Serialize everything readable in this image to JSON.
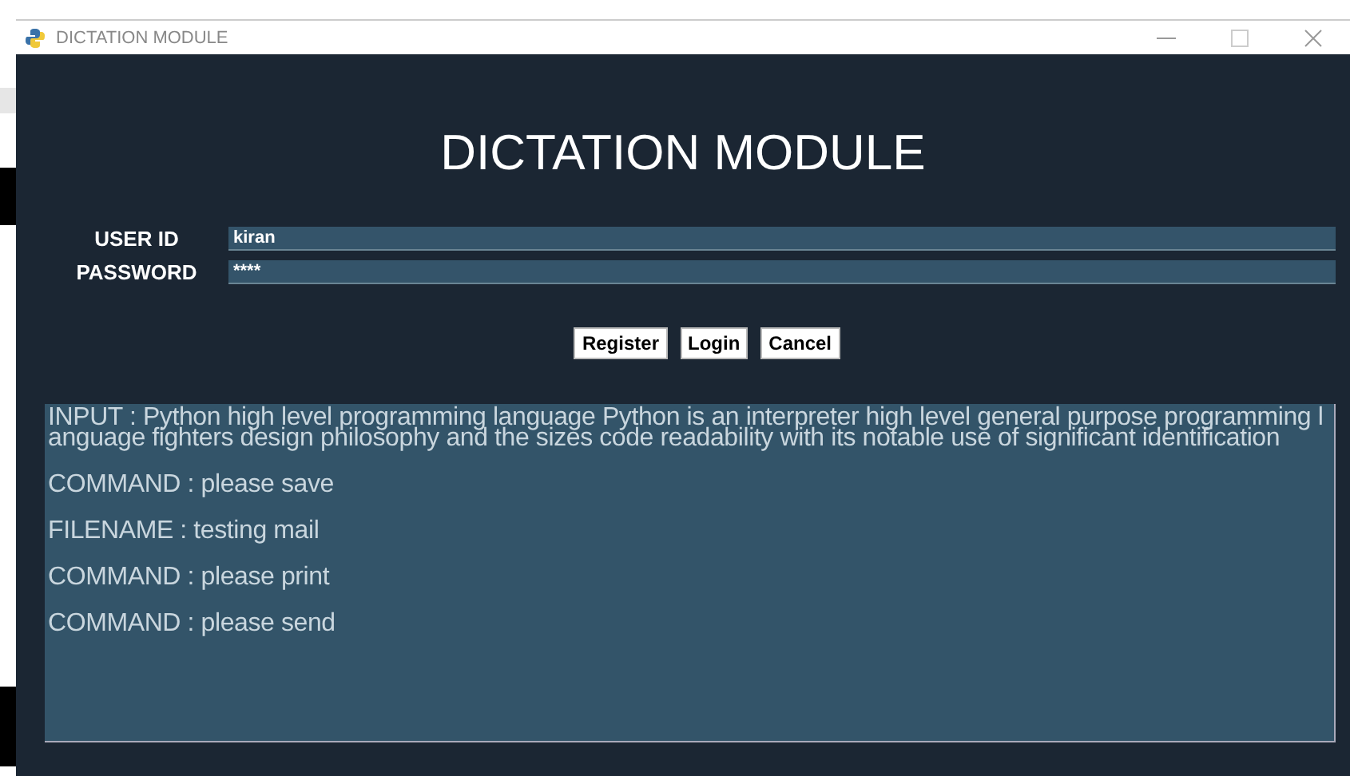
{
  "window": {
    "title": "DICTATION MODULE"
  },
  "heading": "DICTATION MODULE",
  "fields": [
    {
      "label": "USER ID",
      "value": "kiran"
    },
    {
      "label": "PASSWORD",
      "value": "****"
    }
  ],
  "buttons": [
    "Register",
    "Login",
    "Cancel"
  ],
  "log": [
    "INPUT : Python high level programming language Python is an interpreter high level general purpose programming language fighters design philosophy and the sizes code readability with its notable use of significant identification",
    "COMMAND : please save",
    "FILENAME : testing mail",
    "COMMAND : please print",
    "COMMAND : please send"
  ]
}
